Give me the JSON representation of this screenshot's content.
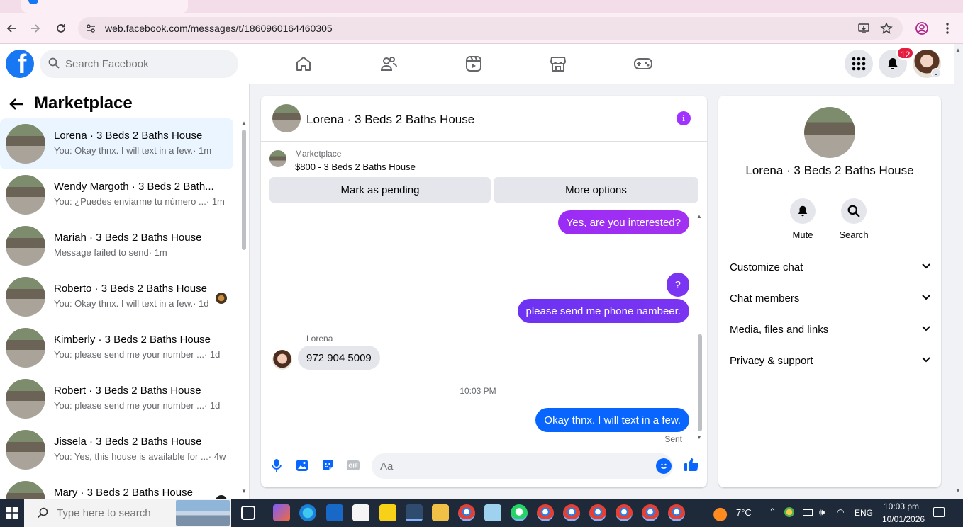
{
  "browser": {
    "url": "web.facebook.com/messages/t/1860960164460305"
  },
  "header": {
    "logo": "f",
    "search_placeholder": "Search Facebook",
    "notification_count": "12"
  },
  "left": {
    "title": "Marketplace",
    "conversations": [
      {
        "name": "Lorena · 3 Beds 2 Baths House",
        "snippet": "You: Okay thnx. I will text in a few.",
        "time": " · 1m"
      },
      {
        "name": "Wendy Margoth · 3 Beds 2 Bath...",
        "snippet": "You: ¿Puedes enviarme tu número ...",
        "time": " · 1m"
      },
      {
        "name": "Mariah · 3 Beds 2 Baths House",
        "snippet": "Message failed to send",
        "time": " · 1m"
      },
      {
        "name": "Roberto · 3 Beds 2 Baths House",
        "snippet": "You: Okay thnx. I will text in a few.",
        "time": " · 1d"
      },
      {
        "name": "Kimberly · 3 Beds 2 Baths House",
        "snippet": "You: please send me your number ...",
        "time": " · 1d"
      },
      {
        "name": "Robert · 3 Beds 2 Baths House",
        "snippet": "You: please send me your number ...",
        "time": " · 1d"
      },
      {
        "name": "Jissela · 3 Beds 2 Baths House",
        "snippet": "You: Yes, this house is available for ...",
        "time": " · 4w"
      },
      {
        "name": "Mary · 3 Beds 2 Baths House",
        "snippet": "",
        "time": ""
      }
    ]
  },
  "chat": {
    "title": "Lorena · 3 Beds 2 Baths House",
    "marketplace_label": "Marketplace",
    "listing": "$800 - 3 Beds 2 Baths House",
    "btn_pending": "Mark as pending",
    "btn_more": "More options",
    "msg_interested": "Yes, are you interested?",
    "msg_question": "?",
    "msg_phone": "please send me phone nambeer.",
    "sender_name": "Lorena",
    "msg_number": "972 904 5009",
    "timestamp": "10:03 PM",
    "msg_thanks": "Okay thnx. I will text in a few.",
    "sent_label": "Sent",
    "composer_placeholder": "Aa"
  },
  "info": {
    "name": "Lorena · 3 Beds 2 Baths House",
    "mute_label": "Mute",
    "search_label": "Search",
    "rows": [
      "Customize chat",
      "Chat members",
      "Media, files and links",
      "Privacy & support"
    ]
  },
  "taskbar": {
    "search_placeholder": "Type here to search",
    "temperature": "7°C",
    "language": "ENG",
    "time": "10:03 pm",
    "date": "10/01/2026"
  },
  "colors": {
    "accent": "#0866ff",
    "purple": "#a033ff",
    "gradient_start": "#9b2cf5",
    "gradient_end": "#5b3ef0"
  }
}
